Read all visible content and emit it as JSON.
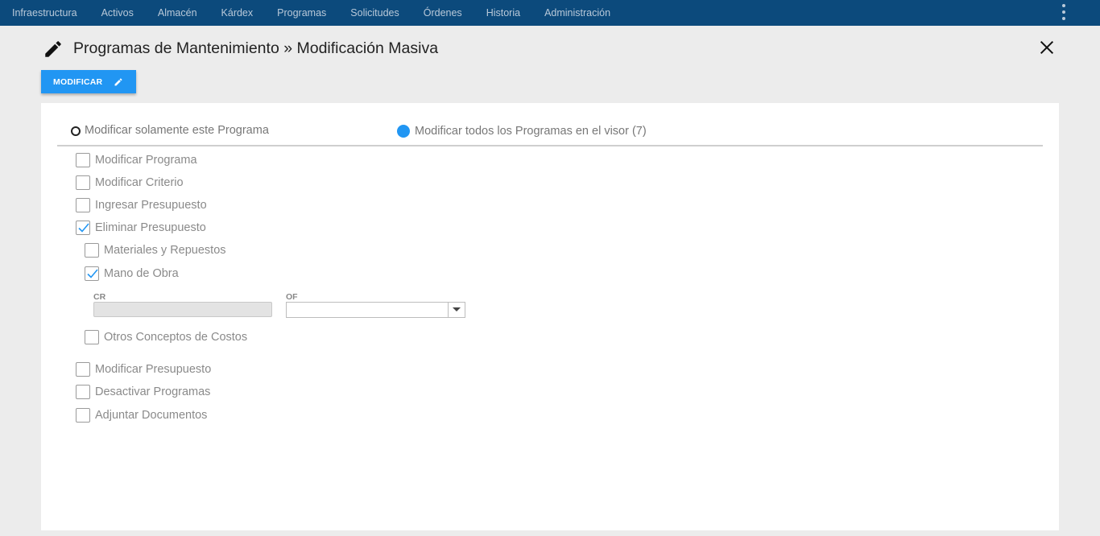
{
  "nav": {
    "items": [
      "Infraestructura",
      "Activos",
      "Almacén",
      "Kárdex",
      "Programas",
      "Solicitudes",
      "Órdenes",
      "Historia",
      "Administración"
    ]
  },
  "header": {
    "title": "Programas de Mantenimiento » Modificación Masiva"
  },
  "toolbar": {
    "modify_label": "MODIFICAR"
  },
  "scope": {
    "option_single": "Modificar solamente este Programa",
    "option_all": "Modificar todos los Programas en el visor (7)",
    "selected": "all"
  },
  "options": {
    "modificar_programa": "Modificar Programa",
    "modificar_criterio": "Modificar Criterio",
    "ingresar_presupuesto": "Ingresar Presupuesto",
    "eliminar_presupuesto": "Eliminar Presupuesto",
    "materiales": "Materiales y Repuestos",
    "mano_obra": "Mano de Obra",
    "otros_conceptos": "Otros Conceptos de Costos",
    "modificar_presupuesto": "Modificar Presupuesto",
    "desactivar_programas": "Desactivar Programas",
    "adjuntar_documentos": "Adjuntar Documentos"
  },
  "fields": {
    "cr_label": "CR",
    "cr_value": "",
    "of_label": "OF",
    "of_value": ""
  },
  "colors": {
    "nav_bg": "#0c4a7c",
    "accent": "#2196f3"
  }
}
